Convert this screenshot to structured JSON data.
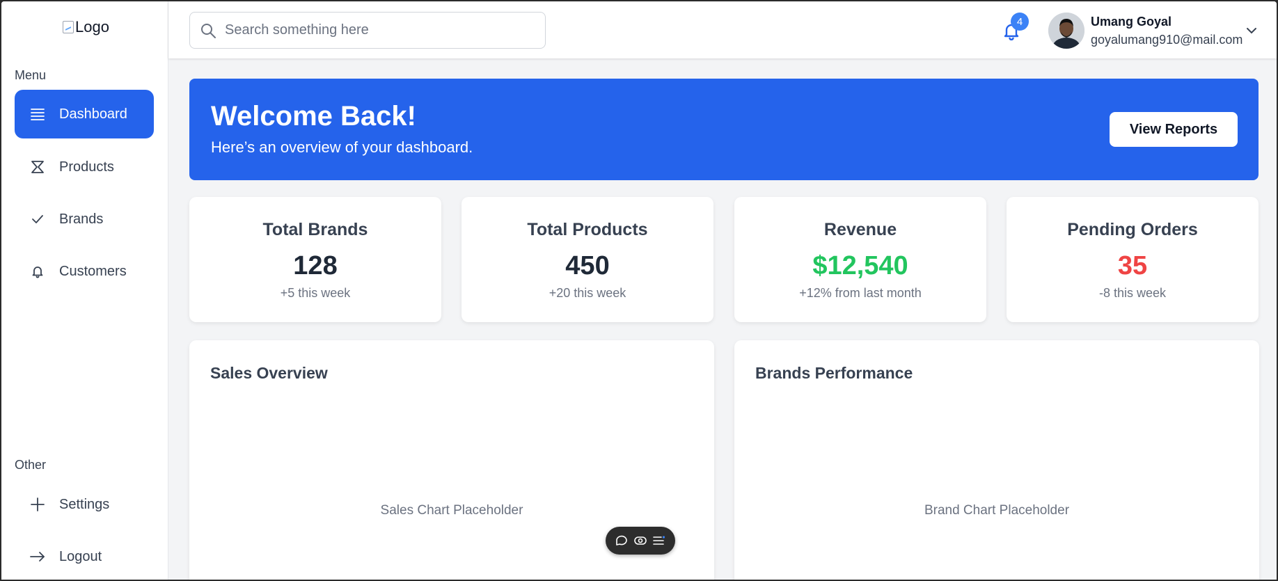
{
  "sidebar": {
    "logo_alt": "Logo",
    "menu_label": "Menu",
    "menu_items": [
      {
        "label": "Dashboard",
        "icon": "list-icon"
      },
      {
        "label": "Products",
        "icon": "hourglass-icon"
      },
      {
        "label": "Brands",
        "icon": "check-icon"
      },
      {
        "label": "Customers",
        "icon": "bell-icon"
      }
    ],
    "other_label": "Other",
    "other_items": [
      {
        "label": "Settings",
        "icon": "plus-icon"
      },
      {
        "label": "Logout",
        "icon": "arrow-right-icon"
      }
    ]
  },
  "header": {
    "search_placeholder": "Search something here",
    "notification_count": "4",
    "user_name": "Umang Goyal",
    "user_email": "goyalumang910@mail.com"
  },
  "banner": {
    "title": "Welcome Back!",
    "subtitle": "Here’s an overview of your dashboard.",
    "button_label": "View Reports"
  },
  "stats": [
    {
      "title": "Total Brands",
      "value": "128",
      "note": "+5 this week"
    },
    {
      "title": "Total Products",
      "value": "450",
      "note": "+20 this week"
    },
    {
      "title": "Revenue",
      "value": "$12,540",
      "note": "+12% from last month"
    },
    {
      "title": "Pending Orders",
      "value": "35",
      "note": "-8 this week"
    }
  ],
  "charts": [
    {
      "title": "Sales Overview",
      "placeholder": "Sales Chart Placeholder"
    },
    {
      "title": "Brands Performance",
      "placeholder": "Brand Chart Placeholder"
    }
  ],
  "colors": {
    "primary": "#2563eb",
    "revenue_value": "#22c55e",
    "pending_value": "#ef4444",
    "badge": "#3b82f6"
  }
}
